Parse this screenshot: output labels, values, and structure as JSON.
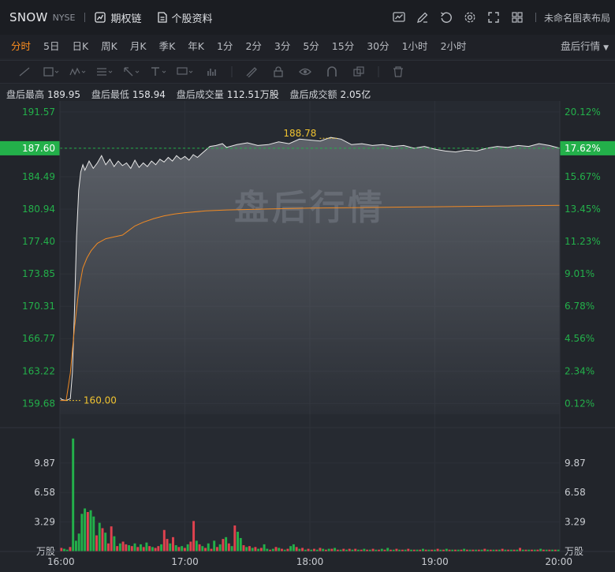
{
  "header": {
    "symbol": "SNOW",
    "exchange": "NYSE",
    "options_label": "期权链",
    "profile_label": "个股资料",
    "layout_label": "未命名图表布局",
    "icons": [
      "indicator-icon",
      "draw-icon",
      "undo-icon",
      "settings-icon",
      "fullscreen-icon",
      "layout-grid-icon"
    ]
  },
  "periods": {
    "items": [
      "分时",
      "5日",
      "日K",
      "周K",
      "月K",
      "季K",
      "年K",
      "1分",
      "2分",
      "3分",
      "5分",
      "15分",
      "30分",
      "1小时",
      "2小时"
    ],
    "active": "分时",
    "session_selector": "盘后行情"
  },
  "stats": {
    "high_label": "盘后最高",
    "high": "189.95",
    "low_label": "盘后最低",
    "low": "158.94",
    "volume_label": "盘后成交量",
    "volume": "112.51万股",
    "amount_label": "盘后成交额",
    "amount": "2.05亿"
  },
  "chart_data": {
    "type": "line",
    "watermark": "盘后行情",
    "price_axis": {
      "ticks": [
        "191.57",
        "187.60",
        "184.49",
        "180.94",
        "177.40",
        "173.85",
        "170.31",
        "166.77",
        "163.22",
        "159.68"
      ],
      "values": [
        191.57,
        187.6,
        184.49,
        180.94,
        177.4,
        173.85,
        170.31,
        166.77,
        163.22,
        159.68
      ],
      "ylim": [
        158.5,
        192.6
      ]
    },
    "pct_axis": {
      "ticks": [
        "20.12%",
        "17.62%",
        "15.67%",
        "13.45%",
        "11.23%",
        "9.01%",
        "6.78%",
        "4.56%",
        "2.34%",
        "0.12%"
      ]
    },
    "current": {
      "price": "187.60",
      "pct": "17.62%"
    },
    "annotations": {
      "high": "188.78",
      "low": "160.00"
    },
    "time_axis": {
      "labels": [
        "16:00",
        "17:00",
        "18:00",
        "19:00",
        "20:00"
      ],
      "range": [
        0,
        240
      ]
    },
    "series": [
      {
        "name": "price",
        "color": "#e8e8e8",
        "points": [
          [
            0,
            160.3
          ],
          [
            1,
            160.1
          ],
          [
            3,
            160.0
          ],
          [
            5,
            160.2
          ],
          [
            6,
            163
          ],
          [
            7,
            170
          ],
          [
            8,
            178
          ],
          [
            9,
            183
          ],
          [
            10,
            185
          ],
          [
            11,
            185.8
          ],
          [
            12,
            185.2
          ],
          [
            14,
            186.2
          ],
          [
            16,
            185.4
          ],
          [
            18,
            186.0
          ],
          [
            20,
            186.8
          ],
          [
            22,
            185.8
          ],
          [
            24,
            186.4
          ],
          [
            26,
            185.6
          ],
          [
            28,
            186.2
          ],
          [
            30,
            185.7
          ],
          [
            32,
            186.0
          ],
          [
            34,
            185.4
          ],
          [
            36,
            186.3
          ],
          [
            38,
            185.5
          ],
          [
            40,
            186.0
          ],
          [
            42,
            185.6
          ],
          [
            44,
            186.2
          ],
          [
            46,
            185.8
          ],
          [
            48,
            186.4
          ],
          [
            50,
            186.1
          ],
          [
            52,
            186.6
          ],
          [
            54,
            186.2
          ],
          [
            56,
            186.8
          ],
          [
            58,
            186.4
          ],
          [
            60,
            186.7
          ],
          [
            62,
            186.3
          ],
          [
            64,
            186.9
          ],
          [
            66,
            186.6
          ],
          [
            68,
            187.0
          ],
          [
            70,
            187.4
          ],
          [
            72,
            187.8
          ],
          [
            75,
            187.9
          ],
          [
            78,
            188.1
          ],
          [
            80,
            187.7
          ],
          [
            85,
            188.0
          ],
          [
            90,
            188.2
          ],
          [
            95,
            187.9
          ],
          [
            100,
            188.0
          ],
          [
            105,
            188.3
          ],
          [
            110,
            188.1
          ],
          [
            115,
            188.6
          ],
          [
            120,
            188.5
          ],
          [
            125,
            188.4
          ],
          [
            130,
            188.78
          ],
          [
            135,
            188.6
          ],
          [
            140,
            188.0
          ],
          [
            145,
            188.1
          ],
          [
            150,
            187.9
          ],
          [
            155,
            188.0
          ],
          [
            160,
            187.8
          ],
          [
            165,
            187.9
          ],
          [
            170,
            187.6
          ],
          [
            175,
            187.8
          ],
          [
            180,
            187.5
          ],
          [
            185,
            187.3
          ],
          [
            190,
            187.2
          ],
          [
            195,
            187.4
          ],
          [
            200,
            187.3
          ],
          [
            205,
            187.6
          ],
          [
            210,
            187.8
          ],
          [
            215,
            187.7
          ],
          [
            220,
            187.9
          ],
          [
            225,
            187.8
          ],
          [
            230,
            188.1
          ],
          [
            235,
            187.9
          ],
          [
            240,
            187.6
          ]
        ]
      },
      {
        "name": "avg",
        "color": "#f08a24",
        "points": [
          [
            0,
            160.0
          ],
          [
            3,
            160.0
          ],
          [
            5,
            163
          ],
          [
            7,
            168
          ],
          [
            9,
            172
          ],
          [
            11,
            174.5
          ],
          [
            13,
            175.6
          ],
          [
            15,
            176.4
          ],
          [
            18,
            177.2
          ],
          [
            22,
            177.7
          ],
          [
            26,
            177.9
          ],
          [
            30,
            178.1
          ],
          [
            33,
            178.6
          ],
          [
            36,
            179.1
          ],
          [
            40,
            179.5
          ],
          [
            45,
            179.9
          ],
          [
            50,
            180.2
          ],
          [
            55,
            180.4
          ],
          [
            60,
            180.55
          ],
          [
            70,
            180.75
          ],
          [
            80,
            180.85
          ],
          [
            100,
            180.95
          ],
          [
            120,
            181.05
          ],
          [
            140,
            181.1
          ],
          [
            160,
            181.15
          ],
          [
            180,
            181.2
          ],
          [
            200,
            181.25
          ],
          [
            220,
            181.3
          ],
          [
            240,
            181.35
          ]
        ]
      }
    ],
    "volume": {
      "unit": "万股",
      "ticks": [
        "9.87",
        "6.58",
        "3.29"
      ],
      "ylim": [
        0,
        13.2
      ],
      "bars": [
        0.4,
        0.3,
        0.2,
        0.5,
        12.6,
        1.2,
        2.0,
        4.2,
        4.8,
        4.4,
        4.6,
        3.9,
        1.8,
        3.2,
        2.6,
        2.1,
        0.9,
        2.8,
        1.7,
        0.6,
        0.9,
        1.1,
        0.8,
        0.7,
        0.6,
        0.9,
        0.5,
        0.8,
        0.5,
        1.0,
        0.6,
        0.5,
        0.4,
        0.6,
        0.8,
        2.4,
        1.4,
        0.9,
        1.6,
        0.7,
        0.5,
        0.6,
        0.4,
        0.8,
        1.1,
        3.4,
        1.2,
        0.8,
        0.6,
        0.4,
        0.9,
        0.3,
        1.2,
        0.5,
        0.8,
        1.4,
        1.6,
        0.9,
        0.6,
        2.9,
        2.2,
        1.5,
        0.7,
        0.5,
        0.6,
        0.4,
        0.5,
        0.3,
        0.4,
        0.8,
        0.3,
        0.2,
        0.3,
        0.5,
        0.4,
        0.3,
        0.2,
        0.3,
        0.6,
        0.8,
        0.5,
        0.3,
        0.4,
        0.2,
        0.3,
        0.2,
        0.3,
        0.2,
        0.4,
        0.3,
        0.2,
        0.3,
        0.3,
        0.4,
        0.2,
        0.2,
        0.3,
        0.2,
        0.3,
        0.2,
        0.3,
        0.2,
        0.2,
        0.3,
        0.2,
        0.2,
        0.3,
        0.2,
        0.2,
        0.3,
        0.2,
        0.4,
        0.2,
        0.2,
        0.3,
        0.2,
        0.2,
        0.2,
        0.3,
        0.2,
        0.2,
        0.2,
        0.2,
        0.3,
        0.2,
        0.2,
        0.2,
        0.2,
        0.3,
        0.2,
        0.2,
        0.3,
        0.2,
        0.2,
        0.2,
        0.2,
        0.2,
        0.3,
        0.2,
        0.2,
        0.2,
        0.2,
        0.2,
        0.2,
        0.3,
        0.2,
        0.2,
        0.2,
        0.2,
        0.2,
        0.3,
        0.2,
        0.2,
        0.2,
        0.2,
        0.2,
        0.4,
        0.2,
        0.2,
        0.2,
        0.2,
        0.2,
        0.2,
        0.3,
        0.2,
        0.2,
        0.2,
        0.2,
        0.2,
        0.2
      ],
      "bar_colors": [
        "r",
        "g",
        "g",
        "r",
        "g",
        "g",
        "g",
        "g",
        "g",
        "r",
        "g",
        "g",
        "r",
        "g",
        "r",
        "g",
        "r",
        "r",
        "g",
        "r",
        "g",
        "r",
        "r",
        "g",
        "r",
        "g",
        "r",
        "g",
        "r",
        "g",
        "r",
        "g",
        "r",
        "r",
        "g",
        "r",
        "r",
        "g",
        "r",
        "g",
        "r",
        "g",
        "r",
        "g",
        "r",
        "r",
        "g",
        "r",
        "g",
        "r",
        "g",
        "r",
        "g",
        "r",
        "g",
        "r",
        "g",
        "r",
        "g",
        "r",
        "g",
        "g",
        "r",
        "g",
        "r",
        "g",
        "r",
        "g",
        "r",
        "g",
        "g",
        "r",
        "g",
        "r",
        "g",
        "r",
        "g",
        "r",
        "g",
        "g",
        "r",
        "g",
        "r",
        "g",
        "r",
        "g",
        "r",
        "g",
        "r",
        "g",
        "r",
        "g",
        "r",
        "g",
        "r",
        "g",
        "r",
        "g",
        "r",
        "g",
        "r",
        "g",
        "r",
        "g",
        "r",
        "g",
        "r",
        "g",
        "r",
        "g",
        "r",
        "g",
        "r",
        "g",
        "r",
        "g",
        "r",
        "g",
        "r",
        "g",
        "r",
        "g",
        "r",
        "g",
        "r",
        "g",
        "r",
        "g",
        "r",
        "g",
        "r",
        "g",
        "r",
        "g",
        "r",
        "g",
        "r",
        "g",
        "r",
        "g",
        "r",
        "g",
        "r",
        "g",
        "r",
        "g",
        "r",
        "g",
        "r",
        "g",
        "r",
        "g",
        "r",
        "g",
        "r",
        "g",
        "r",
        "g",
        "r",
        "g",
        "r",
        "g",
        "r",
        "g",
        "r",
        "g",
        "r",
        "g",
        "r",
        "g"
      ]
    },
    "colors": {
      "up": "#23b04a",
      "down": "#e0424f",
      "current_tag": "#23b04a",
      "annotation": "#f0c330",
      "grid": "#2d3139"
    }
  }
}
